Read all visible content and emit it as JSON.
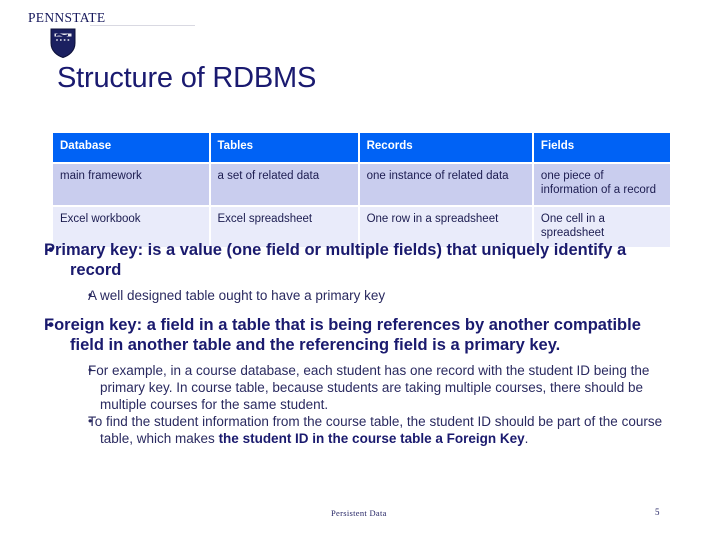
{
  "logo": {
    "wordmark_pre": "P",
    "wordmark": "PENNSTATE",
    "shield_icon": "penn-state-shield-icon"
  },
  "title": "Structure of RDBMS",
  "table": {
    "headers": [
      "Database",
      "Tables",
      "Records",
      "Fields"
    ],
    "rows": [
      [
        "main framework",
        "a set of related data",
        "one instance of related data",
        "one piece of information of a record"
      ],
      [
        "Excel workbook",
        "Excel spreadsheet",
        "One row in a spreadsheet",
        "One cell in a spreadsheet"
      ]
    ],
    "colors": {
      "header_bg": "#0062f5",
      "header_text": "#ffffff",
      "row1_bg": "#c9cdee",
      "row2_bg": "#e9ebfa",
      "cell_text": "#1c1c50"
    }
  },
  "bullets": {
    "primary_key": "Primary key: is a value (one field or multiple fields) that uniquely identify a record",
    "primary_key_sub": "A well designed table ought to have a primary key",
    "foreign_key": "Foreign key: a field in a table that is being references by another compatible field in another table and the referencing field is a primary key.",
    "example": "For example, in a course database, each student has one record with the student ID being the primary key. In course table, because students are taking multiple courses, there should be multiple courses for the same student.",
    "lookup_prefix": "To find the student information from the course table, the student ID should be part of the course table, which makes ",
    "lookup_bold": "the student ID in the course table a Foreign Key",
    "lookup_suffix": ".",
    "marker": "•"
  },
  "footer": {
    "label": "Persistent Data",
    "page_number": "5"
  },
  "colors": {
    "title": "#1a1a70",
    "body_text": "#2a2a60",
    "heading_text": "#1a1a6e",
    "shield_navy": "#1b2060",
    "background": "#ffffff"
  }
}
